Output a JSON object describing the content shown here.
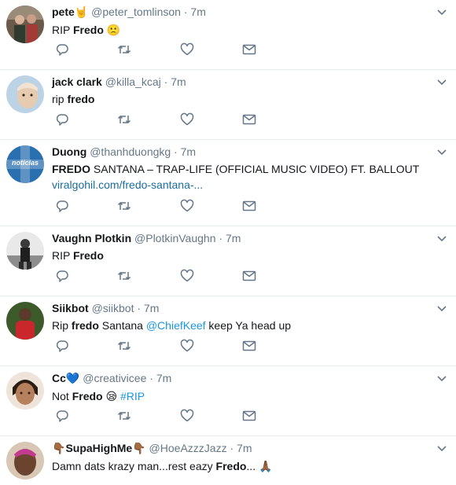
{
  "tweets": [
    {
      "name": "pete",
      "name_emoji": "🤘",
      "handle": "@peter_tomlinson",
      "time": "7m",
      "text_prefix": "RIP ",
      "text_bold": "Fredo",
      "text_suffix": " ",
      "text_emoji": "🙁"
    },
    {
      "name": "jack clark",
      "handle": "@killa_kcaj",
      "time": "7m",
      "text_prefix": "rip ",
      "text_bold": "fredo"
    },
    {
      "name": "Duong",
      "handle": "@thanhduongkg",
      "time": "7m",
      "avatar_label": "noticias",
      "text_bold": "FREDO",
      "text_suffix": " SANTANA – TRAP-LIFE (OFFICIAL MUSIC VIDEO) FT. BALLOUT",
      "link": "viralgohil.com/fredo-santana-..."
    },
    {
      "name": "Vaughn Plotkin",
      "handle": "@PlotkinVaughn",
      "time": "7m",
      "text_prefix": "RIP ",
      "text_bold": "Fredo"
    },
    {
      "name": "Siikbot",
      "handle": "@siikbot",
      "time": "7m",
      "text_prefix": "Rip ",
      "text_bold": "fredo",
      "text_suffix": " Santana ",
      "mention": "@ChiefKeef",
      "text_after": " keep Ya head up"
    },
    {
      "name": "Cc",
      "name_emoji": "💙",
      "handle": "@creativicee",
      "time": "7m",
      "text_prefix": "Not ",
      "text_bold": "Fredo",
      "text_suffix": " ",
      "text_emoji": "😪",
      "hashtag": "#RIP"
    },
    {
      "name": "SupaHighMe",
      "name_emoji_left": "👇🏾",
      "name_emoji_right": "👇🏾",
      "handle": "@HoeAzzzJazz",
      "time": "7m",
      "text_prefix": "Damn dats krazy man...rest eazy ",
      "text_bold": "Fredo",
      "text_suffix": "... ",
      "text_emoji": "🙏🏾"
    }
  ],
  "separator": "·",
  "icons": {
    "reply": "reply-icon",
    "retweet": "retweet-icon",
    "like": "heart-icon",
    "dm": "envelope-icon",
    "menu": "chevron-down-icon"
  },
  "colors": {
    "icon": "#657786",
    "link": "#1b6c9f",
    "hashtag": "#1b95e0",
    "divider": "#e6ecf0"
  }
}
